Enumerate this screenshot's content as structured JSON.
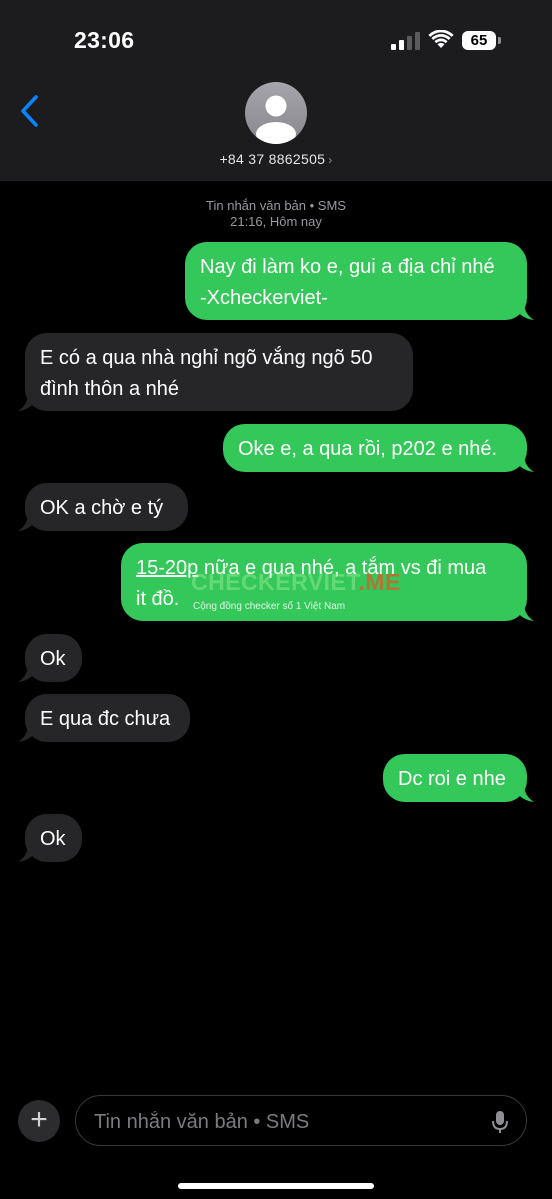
{
  "status_bar": {
    "time": "23:06",
    "battery": "65"
  },
  "header": {
    "contact": "+84 37 8862505",
    "chevron": "›",
    "back_icon": "chevron-left-icon"
  },
  "thread": {
    "meta_line1": "Tin nhắn văn bản • SMS",
    "meta_line2": "21:16, Hôm nay"
  },
  "messages": [
    {
      "dir": "out",
      "lines": [
        "Nay đi làm ko e, gui a địa chỉ nhé",
        "-Xcheckerviet-"
      ]
    },
    {
      "dir": "in",
      "lines": [
        "E có a qua nhà nghỉ ngõ vắng ngõ 50",
        "đình thôn a nhé"
      ]
    },
    {
      "dir": "out",
      "lines": [
        "Oke e, a qua rồi, p202 e nhé."
      ]
    },
    {
      "dir": "in",
      "lines": [
        "OK a chờ e tý"
      ]
    },
    {
      "dir": "out",
      "link": "15-20p",
      "line1_rest": " nữa e qua nhé, a tắm vs đi mua",
      "line2": "it đồ."
    },
    {
      "dir": "in",
      "lines": [
        "Ok"
      ]
    },
    {
      "dir": "in",
      "lines": [
        "E qua đc chưa"
      ]
    },
    {
      "dir": "out",
      "lines": [
        "Dc roi e nhe"
      ]
    },
    {
      "dir": "in",
      "lines": [
        "Ok"
      ]
    }
  ],
  "watermark": {
    "brand": "CHECKERVIET",
    "suffix": ".ME",
    "tagline": "Cộng đồng checker số 1 Việt Nam"
  },
  "composer": {
    "placeholder": "Tin nhắn văn bản • SMS",
    "plus_label": "+",
    "mic_icon": "microphone-icon"
  },
  "colors": {
    "outgoing": "#34c759",
    "incoming": "#262628",
    "accent": "#0a84ff",
    "background": "#000000"
  }
}
